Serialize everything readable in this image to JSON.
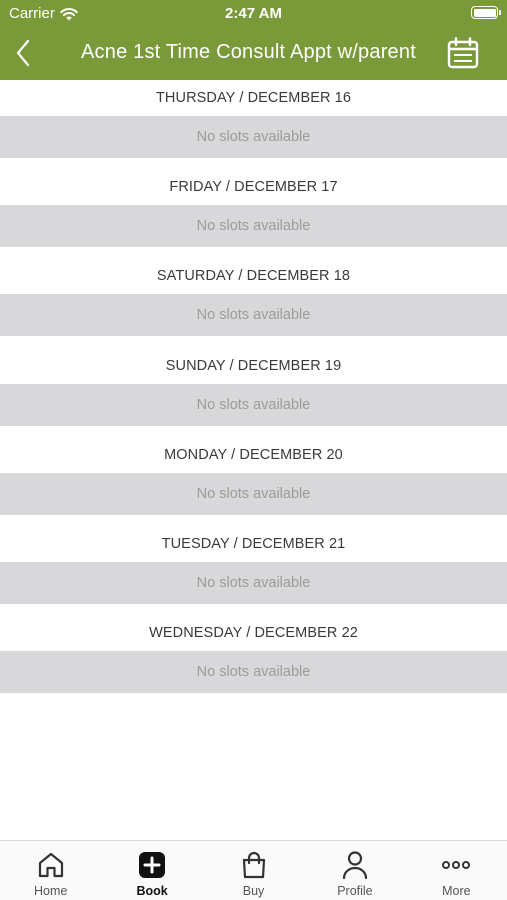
{
  "status_bar": {
    "carrier": "Carrier",
    "time": "2:47 AM"
  },
  "nav": {
    "title": "Acne 1st Time Consult Appt w/parent",
    "back_icon": "chevron-left-icon",
    "calendar_icon": "calendar-icon"
  },
  "days": [
    {
      "label": "THURSDAY / DECEMBER 16",
      "slots": "No slots available"
    },
    {
      "label": "FRIDAY / DECEMBER 17",
      "slots": "No slots available"
    },
    {
      "label": "SATURDAY / DECEMBER 18",
      "slots": "No slots available"
    },
    {
      "label": "SUNDAY / DECEMBER 19",
      "slots": "No slots available"
    },
    {
      "label": "MONDAY / DECEMBER 20",
      "slots": "No slots available"
    },
    {
      "label": "TUESDAY / DECEMBER 21",
      "slots": "No slots available"
    },
    {
      "label": "WEDNESDAY / DECEMBER 22",
      "slots": "No slots available"
    }
  ],
  "tabbar": {
    "tabs": [
      {
        "label": "Home",
        "icon": "home-icon"
      },
      {
        "label": "Book",
        "icon": "plus-square-icon",
        "active": true
      },
      {
        "label": "Buy",
        "icon": "shopping-bag-icon"
      },
      {
        "label": "Profile",
        "icon": "person-icon"
      },
      {
        "label": "More",
        "icon": "more-dots-icon"
      }
    ]
  },
  "colors": {
    "header": "#7a9a3a",
    "slot_background": "#d8d7d9",
    "slot_text": "#9c9c9c"
  }
}
